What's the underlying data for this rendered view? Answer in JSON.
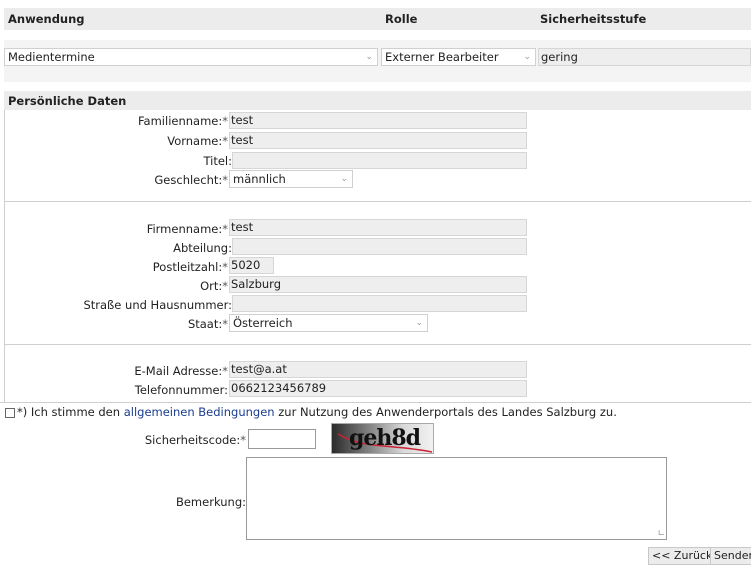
{
  "header": {
    "col_app": "Anwendung",
    "col_role": "Rolle",
    "col_security": "Sicherheitsstufe"
  },
  "application": {
    "app_value": "Medientermine",
    "role_value": "Externer Bearbeiter",
    "security_value": "gering"
  },
  "personal": {
    "section_title": "Persönliche Daten",
    "lastname_label": "Familienname:",
    "lastname_value": "test",
    "firstname_label": "Vorname:",
    "firstname_value": "test",
    "title_label": "Titel:",
    "title_value": "",
    "gender_label": "Geschlecht:",
    "gender_value": "männlich"
  },
  "company": {
    "company_label": "Firmenname:",
    "company_value": "test",
    "department_label": "Abteilung:",
    "department_value": "",
    "zip_label": "Postleitzahl:",
    "zip_value": "5020",
    "city_label": "Ort:",
    "city_value": "Salzburg",
    "street_label": "Straße und Hausnummer:",
    "street_value": "",
    "country_label": "Staat:",
    "country_value": "Österreich"
  },
  "contact": {
    "email_label": "E-Mail Adresse:",
    "email_value": "test@a.at",
    "phone_label": "Telefonnummer:",
    "phone_value": "0662123456789"
  },
  "terms": {
    "prefix": "*) Ich stimme den ",
    "link": "allgemeinen Bedingungen",
    "suffix": " zur Nutzung des Anwenderportals des Landes Salzburg zu."
  },
  "captcha": {
    "label": "Sicherheitscode:",
    "input_value": "",
    "image_text": "geh8d"
  },
  "remark": {
    "label": "Bemerkung:",
    "value": ""
  },
  "buttons": {
    "back": "<< Zurück",
    "send": "Senden"
  },
  "required_mark": "*"
}
